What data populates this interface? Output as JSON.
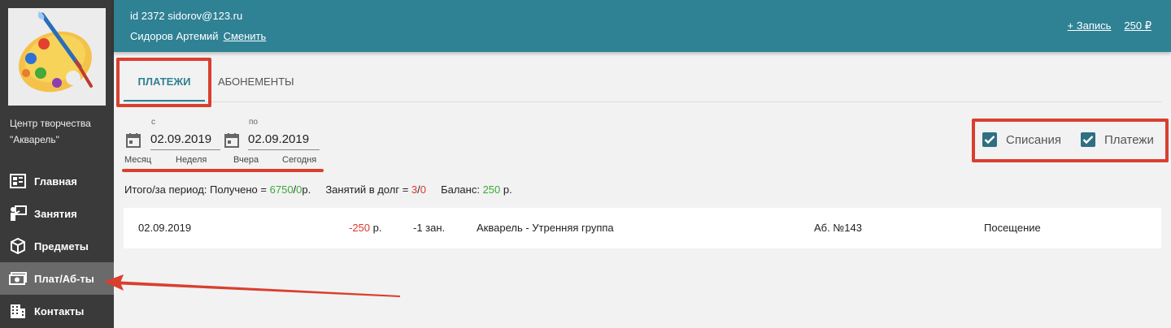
{
  "sidebar": {
    "org_name": "Центр творчества \"Акварель\"",
    "items": [
      {
        "label": "Главная",
        "icon": "dashboard-icon",
        "active": false
      },
      {
        "label": "Занятия",
        "icon": "teacher-icon",
        "active": false
      },
      {
        "label": "Предметы",
        "icon": "cube-icon",
        "active": false
      },
      {
        "label": "Плат/Аб-ты",
        "icon": "money-icon",
        "active": true
      },
      {
        "label": "Контакты",
        "icon": "building-icon",
        "active": false
      }
    ]
  },
  "header": {
    "user_id": "id 2372 sidorov@123.ru",
    "user_name": "Сидоров Артемий",
    "change_link": "Сменить",
    "add_record": "+ Запись",
    "balance": "250 ₽"
  },
  "tabs": [
    {
      "label": "ПЛАТЕЖИ",
      "active": true
    },
    {
      "label": "АБОНЕМЕНТЫ",
      "active": false
    }
  ],
  "filters": {
    "from_label": "с",
    "from_date": "02.09.2019",
    "to_label": "по",
    "to_date": "02.09.2019",
    "quick": [
      "Месяц",
      "Неделя",
      "Вчера",
      "Сегодня"
    ],
    "checkboxes": [
      {
        "label": "Списания",
        "checked": true
      },
      {
        "label": "Платежи",
        "checked": true
      }
    ]
  },
  "summary": {
    "prefix": "Итого/за период: Получено =",
    "received": "6750",
    "slash": "/",
    "received_other": "0",
    "received_unit": "р.",
    "debt_label": "Занятий в долг =",
    "debt_a": "3",
    "debt_b": "0",
    "balance_label": "Баланс:",
    "balance_value": "250",
    "balance_unit": "р."
  },
  "rows": [
    {
      "date": "02.09.2019",
      "amount": "-250",
      "unit": "р.",
      "lessons": "-1 зан.",
      "group": "Акварель - Утренняя группа",
      "subscription": "Аб. №143",
      "type": "Посещение"
    }
  ],
  "colors": {
    "header_bg": "#2f8194",
    "sidebar_bg": "#3a3a3a",
    "accent": "#2f8194",
    "annotation_red": "#d93f2f",
    "positive": "#3aaa35",
    "negative": "#e0362c"
  }
}
